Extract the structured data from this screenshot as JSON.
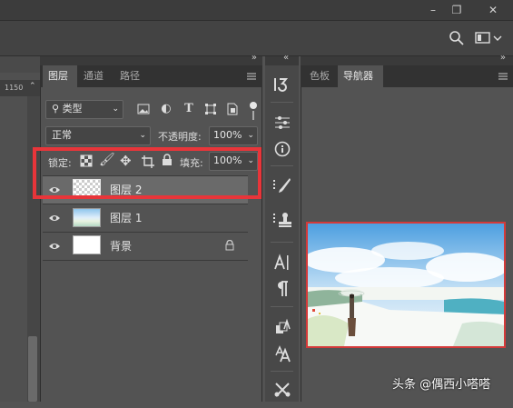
{
  "layers_panel": {
    "tabs": [
      "图层",
      "通道",
      "路径"
    ],
    "filter_kind": "类型",
    "blend_mode": "正常",
    "opacity_label": "不透明度:",
    "opacity_value": "100%",
    "lock_label": "锁定:",
    "fill_label": "填充:",
    "fill_value": "100%",
    "layers": [
      {
        "name": "图层 2",
        "selected": true
      },
      {
        "name": "图层 1",
        "selected": false
      },
      {
        "name": "背景",
        "selected": false
      }
    ]
  },
  "navigator_panel": {
    "tabs": [
      "色板",
      "导航器"
    ]
  },
  "ruler": {
    "label": "1150"
  },
  "watermark": "头条 @偶西小嗒嗒",
  "colors": {
    "highlight": "#e8353a",
    "view_box": "#d43a3a"
  },
  "icons": {
    "window": [
      "minimize-icon",
      "restore-icon",
      "close-icon"
    ],
    "options_bar": [
      "search-icon",
      "workspace-icon"
    ],
    "filter": [
      "image-filter-icon",
      "adjustment-filter-icon",
      "type-filter-icon",
      "shape-filter-icon",
      "smart-object-filter-icon"
    ],
    "lock": [
      "lock-transparent-icon",
      "lock-image-icon",
      "lock-position-icon",
      "lock-artboard-icon",
      "lock-all-icon"
    ],
    "tools": [
      "history-icon",
      "adjustments-icon",
      "info-icon",
      "brush-settings-icon",
      "clone-source-icon",
      "character-icon",
      "paragraph-icon",
      "character-styles-icon",
      "paragraph-styles-icon",
      "tool-presets-icon"
    ]
  }
}
